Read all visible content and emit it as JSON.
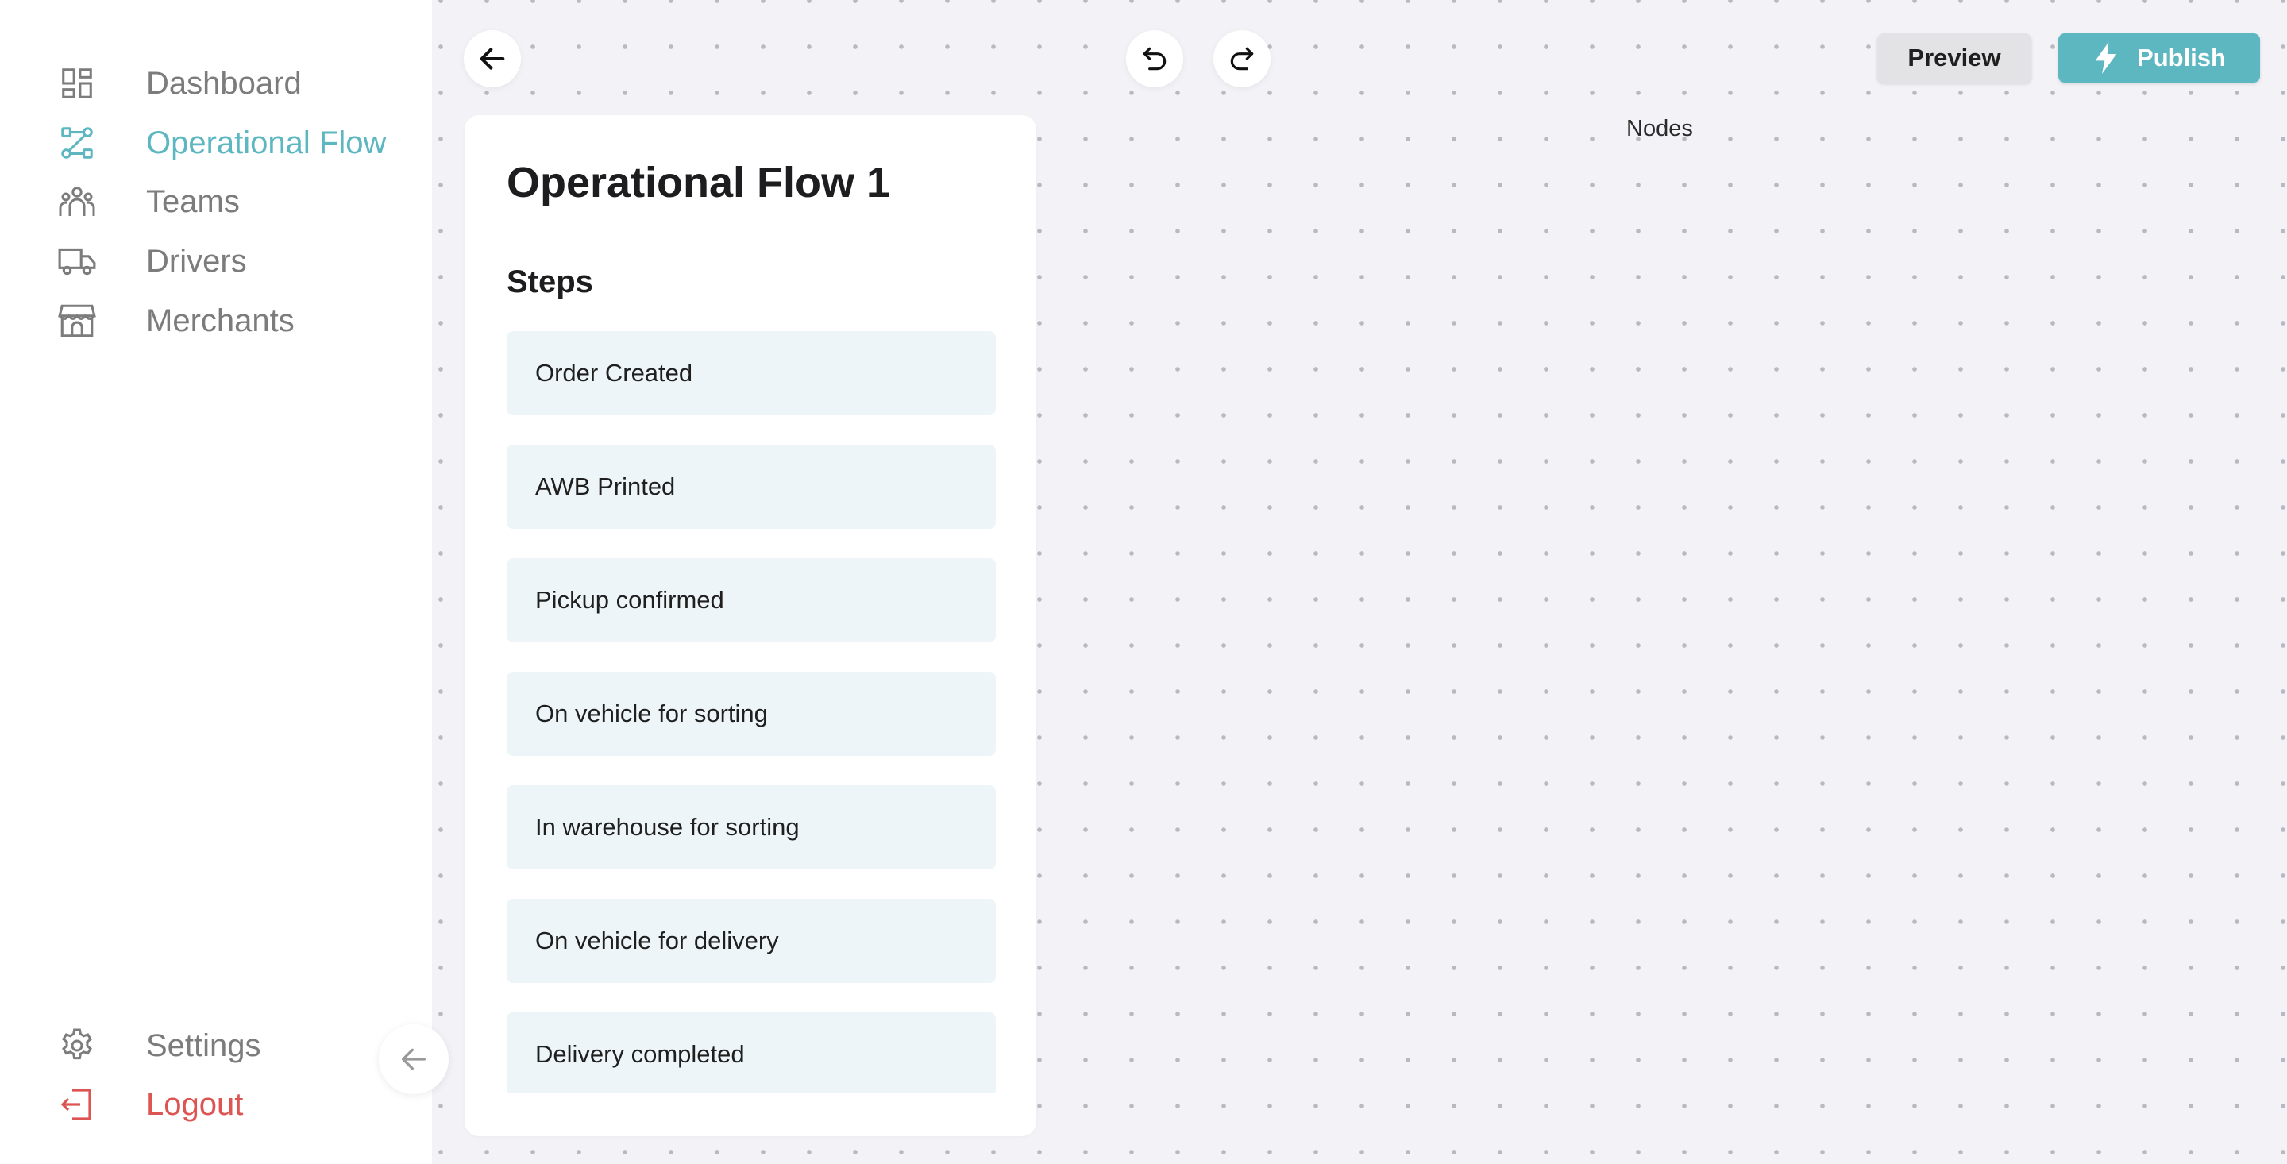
{
  "sidebar": {
    "items": [
      {
        "label": "Dashboard",
        "icon": "dashboard-icon"
      },
      {
        "label": "Operational Flow",
        "icon": "flow-icon",
        "active": true
      },
      {
        "label": "Teams",
        "icon": "teams-icon"
      },
      {
        "label": "Drivers",
        "icon": "truck-icon"
      },
      {
        "label": "Merchants",
        "icon": "store-icon"
      }
    ],
    "bottom": [
      {
        "label": "Settings",
        "icon": "gear-icon"
      },
      {
        "label": "Logout",
        "icon": "logout-icon"
      }
    ]
  },
  "toolbar": {
    "preview_label": "Preview",
    "publish_label": "Publish"
  },
  "canvas": {
    "nodes_label": "Nodes"
  },
  "panel": {
    "title": "Operational Flow 1",
    "steps_heading": "Steps",
    "steps": [
      "Order Created",
      "AWB Printed",
      "Pickup confirmed",
      "On vehicle for sorting",
      "In warehouse for sorting",
      "On vehicle for delivery",
      "Delivery completed"
    ]
  },
  "colors": {
    "accent": "#5db7c1",
    "danger": "#dc5552",
    "muted_text": "#7c7c7c",
    "step_bg": "#edf5f8",
    "canvas_bg": "#f3f3f7"
  }
}
